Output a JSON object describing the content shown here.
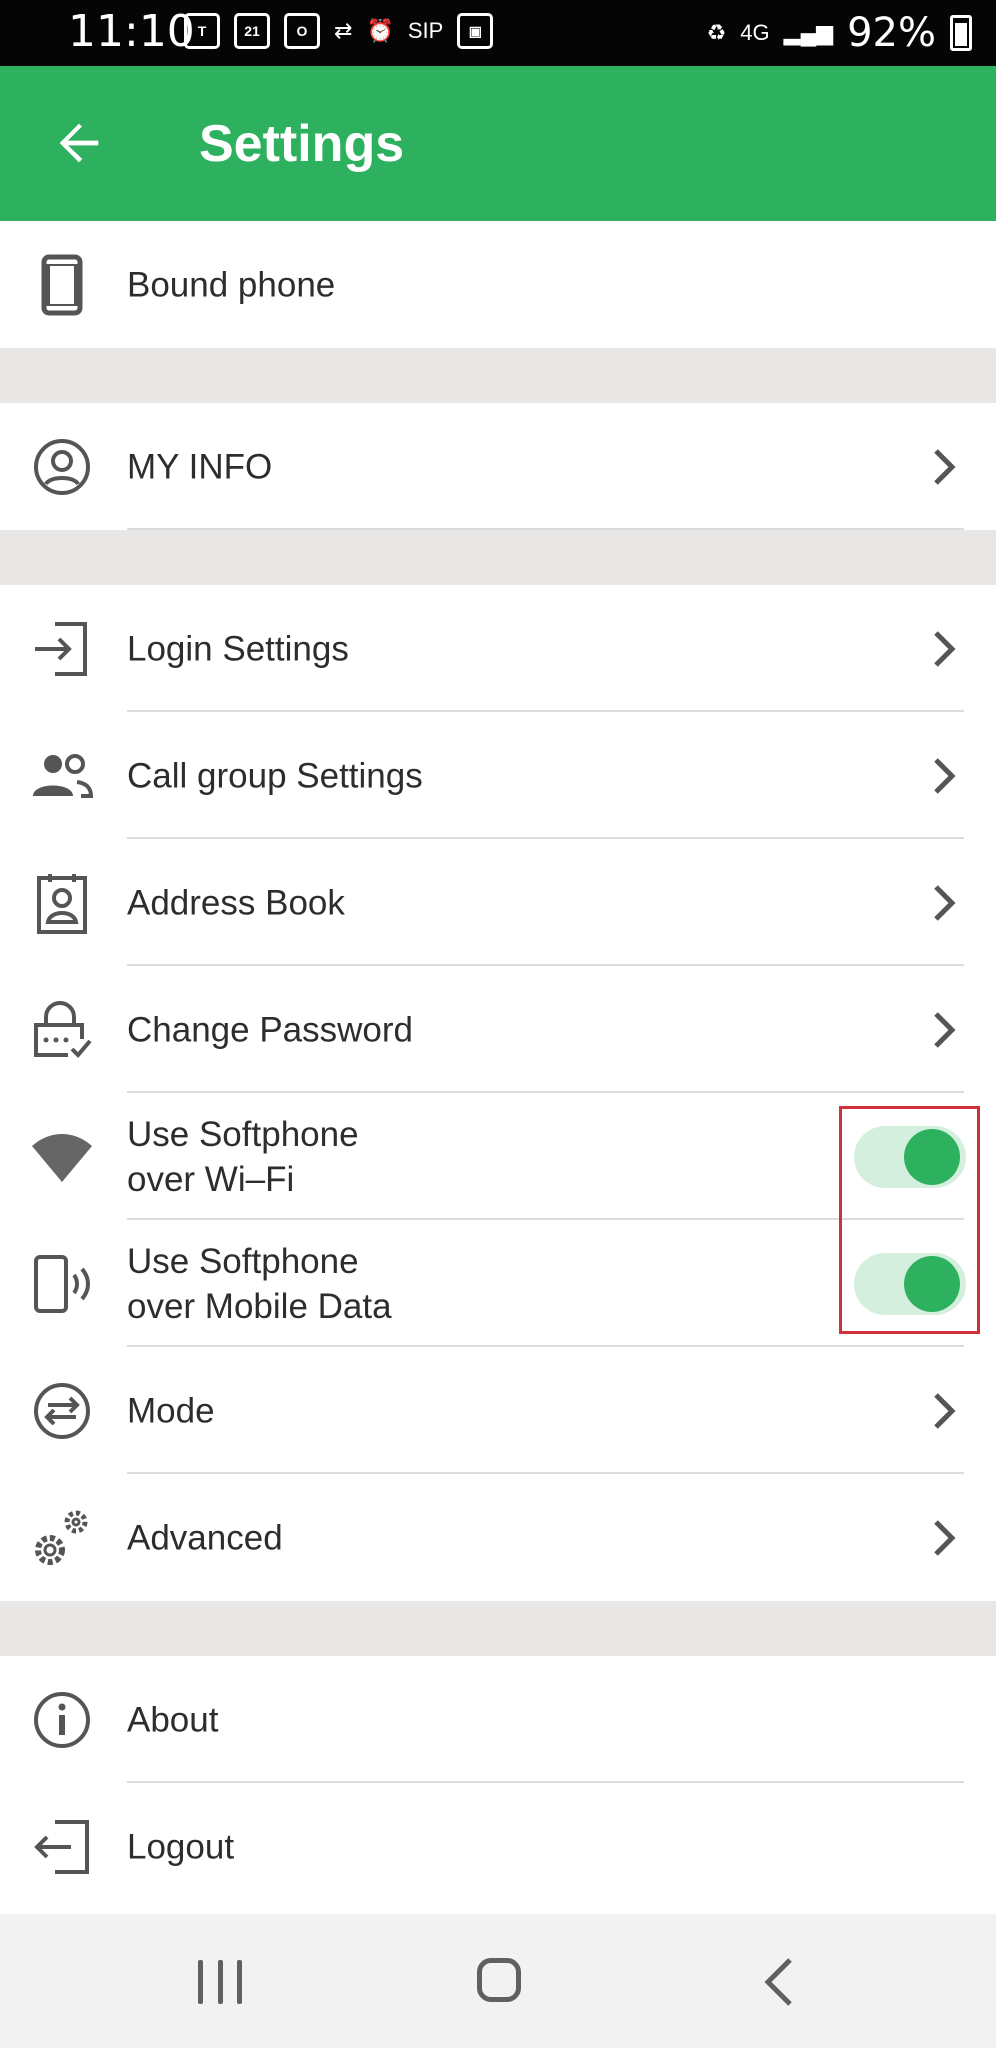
{
  "status_bar": {
    "time": "11:10",
    "calendar_day": "21",
    "sip_label": "SIP",
    "network_label": "4G",
    "battery_percent": "92%"
  },
  "app_bar": {
    "title": "Settings",
    "back_icon": "arrow-left-icon"
  },
  "settings": {
    "bound_phone": {
      "label": "Bound phone",
      "icon": "phone-icon"
    },
    "my_info": {
      "label": "MY INFO",
      "icon": "account-circle-icon"
    },
    "login_settings": {
      "label": "Login Settings",
      "icon": "login-icon"
    },
    "call_group_settings": {
      "label": "Call group Settings",
      "icon": "group-icon"
    },
    "address_book": {
      "label": "Address Book",
      "icon": "contact-card-icon"
    },
    "change_password": {
      "label": "Change Password",
      "icon": "lock-check-icon"
    },
    "softphone_wifi": {
      "label": "Use Softphone\nover Wi–Fi",
      "icon": "wifi-icon",
      "enabled": true
    },
    "softphone_mobile": {
      "label": "Use Softphone\nover Mobile Data",
      "icon": "phone-vibrate-icon",
      "enabled": true
    },
    "mode": {
      "label": "Mode",
      "icon": "swap-circle-icon"
    },
    "advanced": {
      "label": "Advanced",
      "icon": "gears-icon"
    },
    "about": {
      "label": "About",
      "icon": "info-icon"
    },
    "logout": {
      "label": "Logout",
      "icon": "logout-icon"
    }
  },
  "colors": {
    "primary": "#2eb15f",
    "toggle_track": "#d5efdf",
    "highlight": "#d0303a",
    "section_gap": "#e8e7e6"
  }
}
